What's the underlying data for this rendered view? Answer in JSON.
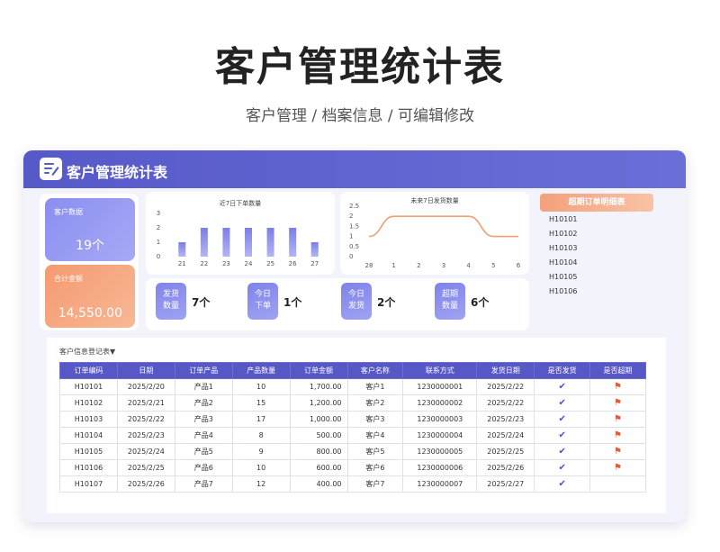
{
  "title": "客户管理统计表",
  "subtitle": "客户管理 / 档案信息 /  可编辑修改",
  "card": {
    "title": "客户管理统计表",
    "logo_icon": "document-edit-icon"
  },
  "stats": {
    "customers_label": "客户数据",
    "customers_value": "19个",
    "amount_label": "合计金额",
    "amount_value": "14,550.00"
  },
  "chart_data": [
    {
      "type": "bar",
      "title": "近7日下单数量",
      "categories": [
        "21",
        "22",
        "23",
        "24",
        "25",
        "26",
        "27"
      ],
      "values": [
        1,
        2,
        2,
        2,
        2,
        2,
        1
      ],
      "ylim": [
        0,
        3
      ],
      "yticks": [
        "0",
        "1",
        "2",
        "3"
      ],
      "color": "#8f92ee",
      "grid": false
    },
    {
      "type": "line",
      "title": "未来7日发货数量",
      "categories": [
        "28",
        "1",
        "2",
        "3",
        "4",
        "5",
        "6"
      ],
      "values": [
        1,
        2,
        2,
        2,
        2,
        1,
        1
      ],
      "ylim": [
        0,
        2.5
      ],
      "yticks": [
        "0",
        "0.5",
        "1",
        "1.5",
        "2",
        "2.5"
      ],
      "color": "#f0a070",
      "grid": false
    }
  ],
  "kpis": [
    {
      "label_1": "发货",
      "label_2": "数量",
      "value": "7个"
    },
    {
      "label_1": "今日",
      "label_2": "下单",
      "value": "1个"
    },
    {
      "label_1": "今日",
      "label_2": "发货",
      "value": "2个"
    },
    {
      "label_1": "超期",
      "label_2": "数量",
      "value": "6个"
    }
  ],
  "overdue": {
    "title": "超期订单明细表",
    "items": [
      "H10101",
      "H10102",
      "H10103",
      "H10104",
      "H10105",
      "H10106"
    ]
  },
  "table": {
    "caption": "客户信息登记表▼",
    "headers": [
      "订单编码",
      "日期",
      "订单产品",
      "产品数量",
      "订单金额",
      "客户名称",
      "联系方式",
      "发货日期",
      "是否发货",
      "是否超期"
    ],
    "rows": [
      [
        "H10101",
        "2025/2/20",
        "产品1",
        "10",
        "1,700.00",
        "客户1",
        "1230000001",
        "2025/2/22",
        "✔",
        "⚑"
      ],
      [
        "H10102",
        "2025/2/21",
        "产品2",
        "15",
        "1,200.00",
        "客户2",
        "1230000002",
        "2025/2/22",
        "✔",
        "⚑"
      ],
      [
        "H10103",
        "2025/2/22",
        "产品3",
        "17",
        "1,000.00",
        "客户3",
        "1230000003",
        "2025/2/23",
        "✔",
        "⚑"
      ],
      [
        "H10104",
        "2025/2/23",
        "产品4",
        "8",
        "500.00",
        "客户4",
        "1230000004",
        "2025/2/24",
        "✔",
        "⚑"
      ],
      [
        "H10105",
        "2025/2/24",
        "产品5",
        "9",
        "800.00",
        "客户5",
        "1230000005",
        "2025/2/25",
        "✔",
        "⚑"
      ],
      [
        "H10106",
        "2025/2/25",
        "产品6",
        "10",
        "600.00",
        "客户6",
        "1230000006",
        "2025/2/26",
        "✔",
        "⚑"
      ],
      [
        "H10107",
        "2025/2/26",
        "产品7",
        "12",
        "400.00",
        "客户7",
        "1230000007",
        "2025/2/27",
        "✔",
        ""
      ]
    ]
  }
}
